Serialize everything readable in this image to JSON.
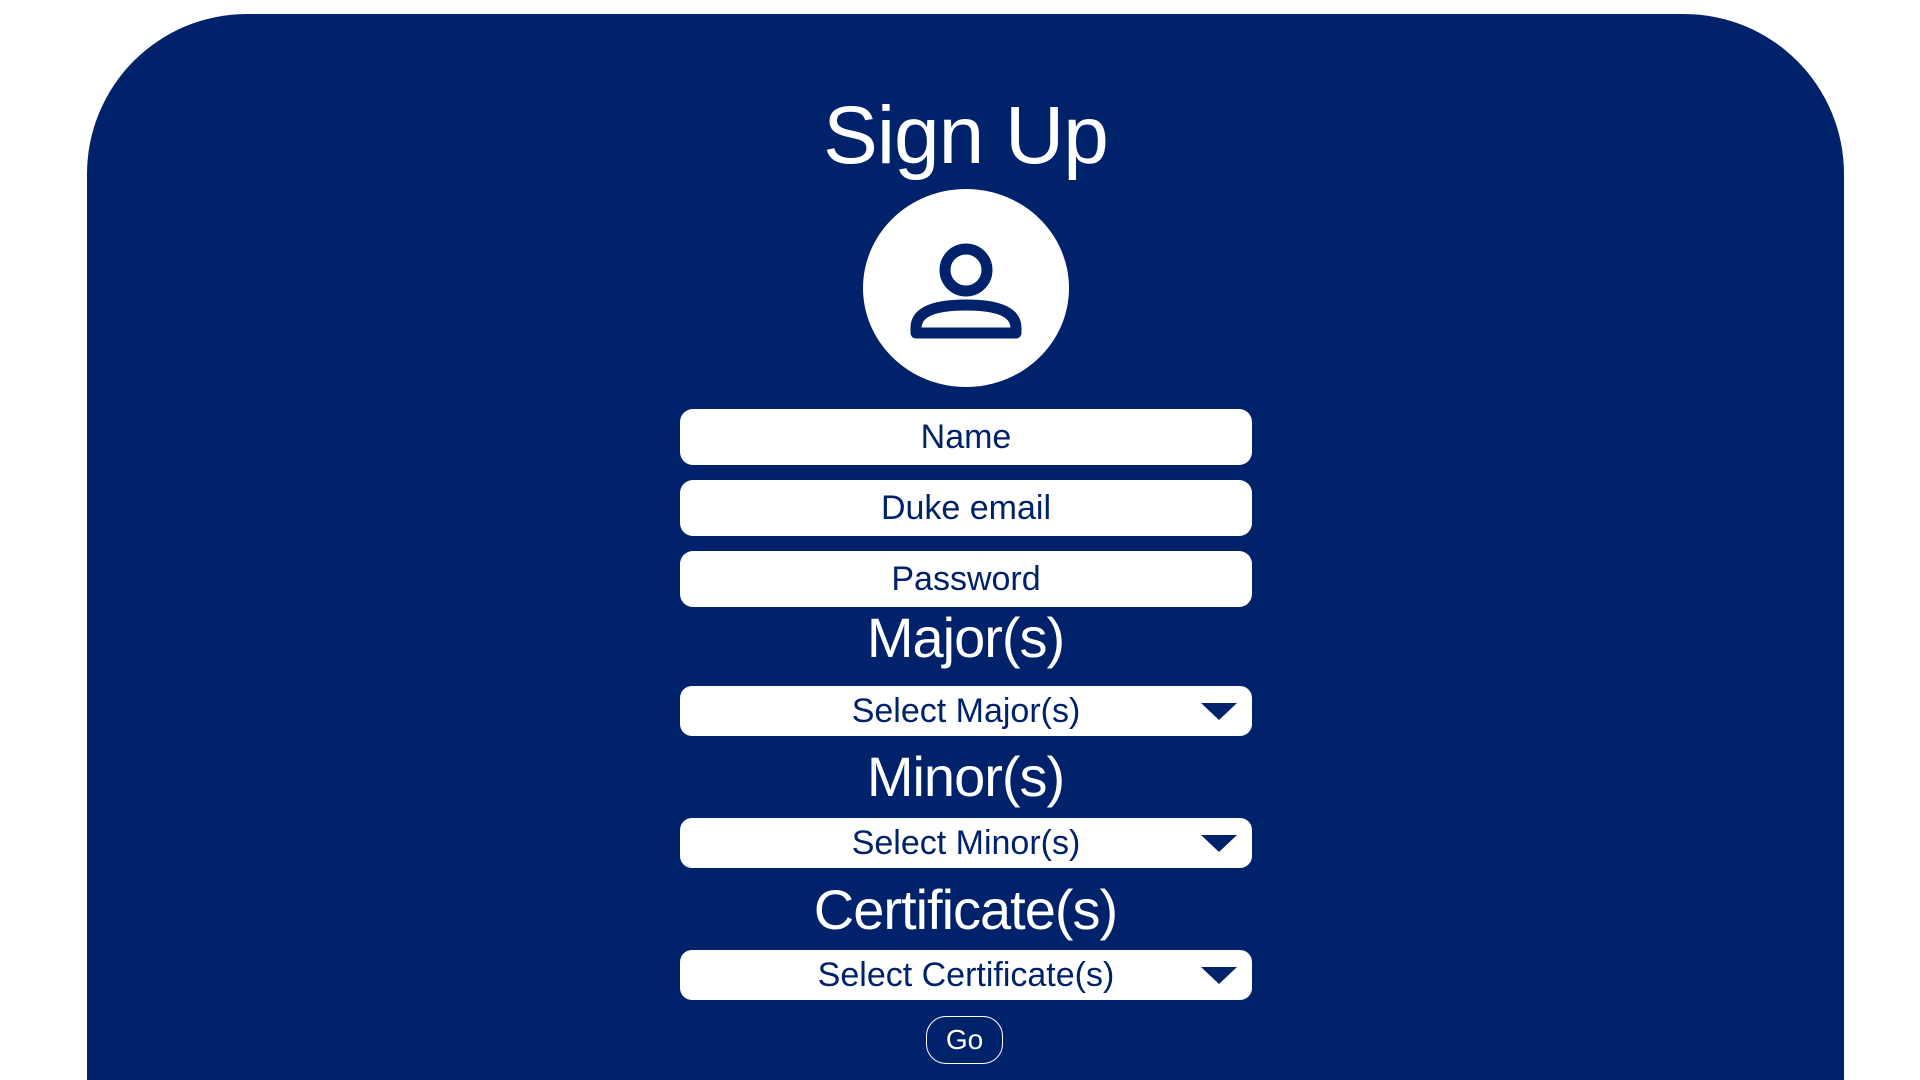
{
  "signup": {
    "title": "Sign Up",
    "avatar_icon": "person-icon",
    "fields": {
      "name_placeholder": "Name",
      "email_placeholder": "Duke email",
      "password_placeholder": "Password"
    },
    "majors": {
      "label": "Major(s)",
      "select_text": "Select Major(s)"
    },
    "minors": {
      "label": "Minor(s)",
      "select_text": "Select Minor(s)"
    },
    "certificates": {
      "label": "Certificate(s)",
      "select_text": "Select Certificate(s)"
    },
    "go_label": "Go"
  },
  "colors": {
    "background": "#00226a",
    "foreground": "#ffffff"
  }
}
